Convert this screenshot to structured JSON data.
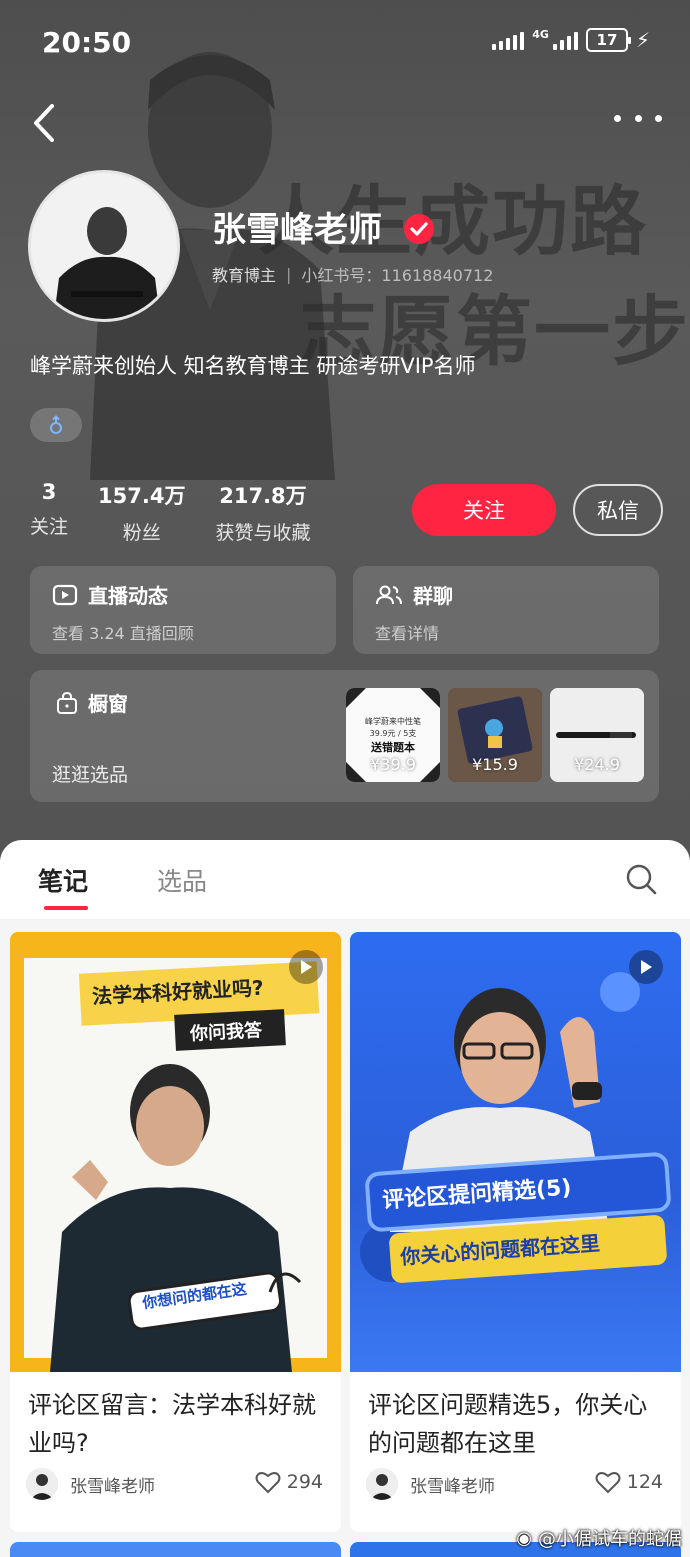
{
  "status_bar": {
    "time": "20:50",
    "network": "4G",
    "battery": "17"
  },
  "background_slogan": {
    "line1": "人生成功路",
    "line2": "志愿第一步"
  },
  "profile": {
    "name": "张雪峰老师",
    "category": "教育博主",
    "red_id_label": "小红书号：11618840712",
    "bio": "峰学蔚来创始人 知名教育博主 研途考研VIP名师",
    "gender": "male"
  },
  "stats": [
    {
      "value": "3",
      "label": "关注"
    },
    {
      "value": "157.4万",
      "label": "粉丝"
    },
    {
      "value": "217.8万",
      "label": "获赞与收藏"
    }
  ],
  "actions": {
    "follow": "关注",
    "message": "私信"
  },
  "cards": {
    "live": {
      "title": "直播动态",
      "subtitle": "查看 3.24 直播回顾"
    },
    "group": {
      "title": "群聊",
      "subtitle": "查看详情"
    },
    "shop": {
      "title": "橱窗",
      "subtitle": "逛逛选品",
      "items": [
        {
          "price": "¥39.9",
          "caption_top": "峰学蔚来中性笔",
          "caption_mid": "39.9元 / 5支",
          "caption_big": "送错题本"
        },
        {
          "price": "¥15.9"
        },
        {
          "price": "¥24.9"
        }
      ]
    }
  },
  "tabs": [
    {
      "label": "笔记"
    },
    {
      "label": "选品"
    }
  ],
  "notes": [
    {
      "cover_heading": "法学本科好就业吗?",
      "cover_subheading": "你问我答",
      "cover_bubble": "你想问的都在这",
      "title": "评论区留言：法学本科好就业吗?",
      "author": "张雪峰老师",
      "likes": "294",
      "cover_color": "#f6b51a"
    },
    {
      "cover_heading": "评论区提问精选(5)",
      "cover_subheading": "你关心的问题都在这里",
      "title": "评论区问题精选5，你关心的问题都在这里",
      "author": "张雪峰老师",
      "likes": "124",
      "cover_color": "#2d6df0"
    }
  ],
  "watermark": "@小倨试车的蛇倨",
  "colors": {
    "accent": "#ff2442",
    "header_bg": "#555555"
  }
}
